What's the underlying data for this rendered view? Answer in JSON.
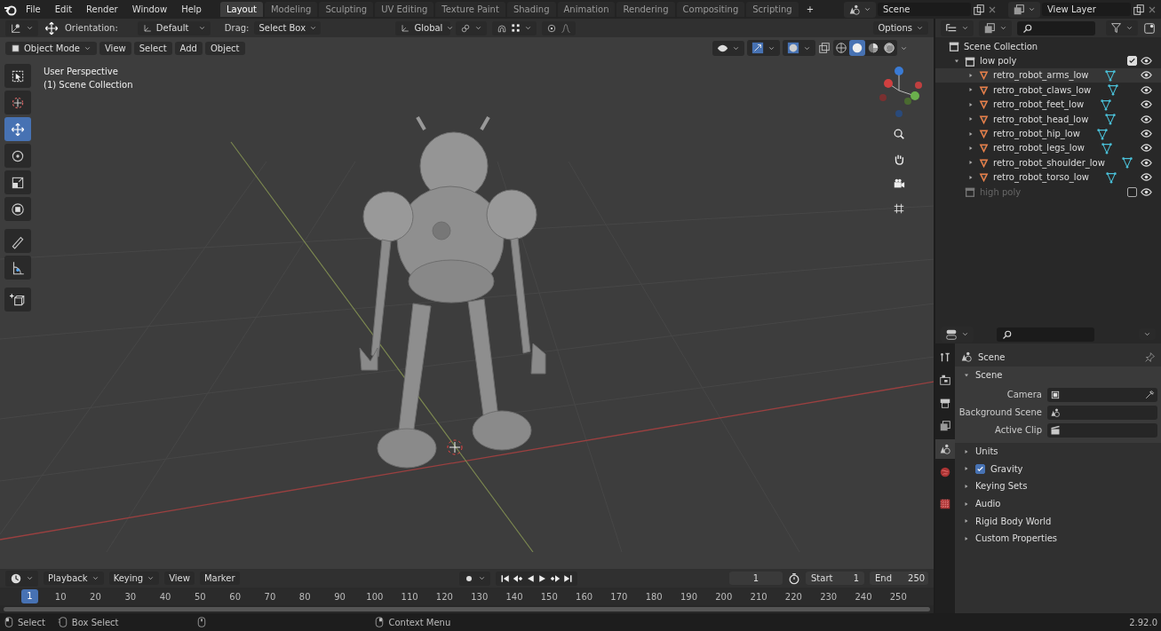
{
  "menu": [
    "File",
    "Edit",
    "Render",
    "Window",
    "Help"
  ],
  "workspaces": [
    {
      "label": "Layout",
      "selected": true
    },
    {
      "label": "Modeling",
      "selected": false
    },
    {
      "label": "Sculpting",
      "selected": false
    },
    {
      "label": "UV Editing",
      "selected": false
    },
    {
      "label": "Texture Paint",
      "selected": false
    },
    {
      "label": "Shading",
      "selected": false
    },
    {
      "label": "Animation",
      "selected": false
    },
    {
      "label": "Rendering",
      "selected": false
    },
    {
      "label": "Compositing",
      "selected": false
    },
    {
      "label": "Scripting",
      "selected": false
    }
  ],
  "add_workspace": "+",
  "scene": {
    "name": "Scene"
  },
  "view_layer": {
    "name": "View Layer"
  },
  "tool_settings": {
    "orientation_label": "Orientation:",
    "orientation": "Default",
    "drag_label": "Drag:",
    "drag": "Select Box",
    "transform_orientation": "Global",
    "options": "Options"
  },
  "viewport": {
    "mode": "Object Mode",
    "menus": [
      "View",
      "Select",
      "Add",
      "Object"
    ],
    "shading": [
      {
        "kind": "wireframe",
        "selected": false
      },
      {
        "kind": "solid",
        "selected": true
      },
      {
        "kind": "material",
        "selected": false
      },
      {
        "kind": "rendered",
        "selected": false
      }
    ],
    "overlay_text": [
      "User Perspective",
      "(1) Scene Collection"
    ],
    "tools": [
      {
        "kind": "select",
        "selected": false
      },
      {
        "kind": "cursor",
        "selected": false
      },
      {
        "kind": "move",
        "selected": true
      },
      {
        "kind": "rotate",
        "selected": false
      },
      {
        "kind": "scale",
        "selected": false
      },
      {
        "kind": "transform",
        "selected": false
      },
      {
        "kind": "annotate",
        "selected": false
      },
      {
        "kind": "measure",
        "selected": false
      },
      {
        "kind": "add_cube",
        "selected": false
      }
    ]
  },
  "outliner": {
    "root": "Scene Collection",
    "collections": [
      {
        "name": "low poly",
        "expanded": true,
        "checked": true,
        "disabled": false,
        "children": [
          {
            "name": "retro_robot_arms_low",
            "selected": true
          },
          {
            "name": "retro_robot_claws_low",
            "selected": false
          },
          {
            "name": "retro_robot_feet_low",
            "selected": false
          },
          {
            "name": "retro_robot_head_low",
            "selected": false
          },
          {
            "name": "retro_robot_hip_low",
            "selected": false
          },
          {
            "name": "retro_robot_legs_low",
            "selected": false
          },
          {
            "name": "retro_robot_shoulder_low",
            "selected": false
          },
          {
            "name": "retro_robot_torso_low",
            "selected": false
          }
        ]
      },
      {
        "name": "high poly",
        "expanded": false,
        "checked": false,
        "disabled": true
      }
    ]
  },
  "properties": {
    "tabs": [
      {
        "kind": "tool",
        "selected": false
      },
      {
        "kind": "render",
        "selected": false
      },
      {
        "kind": "output",
        "selected": false
      },
      {
        "kind": "view_layer",
        "selected": false
      },
      {
        "kind": "scene",
        "selected": true
      },
      {
        "kind": "world",
        "selected": false
      },
      {
        "kind": "texture",
        "selected": false
      }
    ],
    "context": "Scene",
    "panels": [
      {
        "title": "Scene",
        "expanded": true,
        "fields": [
          {
            "label": "Camera",
            "kind": "camera"
          },
          {
            "label": "Background Scene",
            "kind": "scene"
          },
          {
            "label": "Active Clip",
            "kind": "clip"
          }
        ]
      },
      {
        "title": "Units",
        "expanded": false
      },
      {
        "title": "Gravity",
        "expanded": false,
        "checked": true
      },
      {
        "title": "Keying Sets",
        "expanded": false
      },
      {
        "title": "Audio",
        "expanded": false
      },
      {
        "title": "Rigid Body World",
        "expanded": false
      },
      {
        "title": "Custom Properties",
        "expanded": false
      }
    ]
  },
  "timeline": {
    "menus": [
      "Playback",
      "Keying",
      "View",
      "Marker"
    ],
    "current_frame": "1",
    "start_label": "Start",
    "start": "1",
    "end_label": "End",
    "end": "250",
    "marker": "1",
    "ticks": [
      "10",
      "20",
      "30",
      "40",
      "50",
      "60",
      "70",
      "80",
      "90",
      "100",
      "110",
      "120",
      "130",
      "140",
      "150",
      "160",
      "170",
      "180",
      "190",
      "200",
      "210",
      "220",
      "230",
      "240",
      "250"
    ]
  },
  "status_bar": {
    "items": [
      {
        "label": "Select",
        "kind": "left"
      },
      {
        "label": "Box Select",
        "kind": "drag"
      },
      {
        "label": "Context Menu",
        "kind": "right"
      }
    ],
    "version": "2.92.0"
  }
}
